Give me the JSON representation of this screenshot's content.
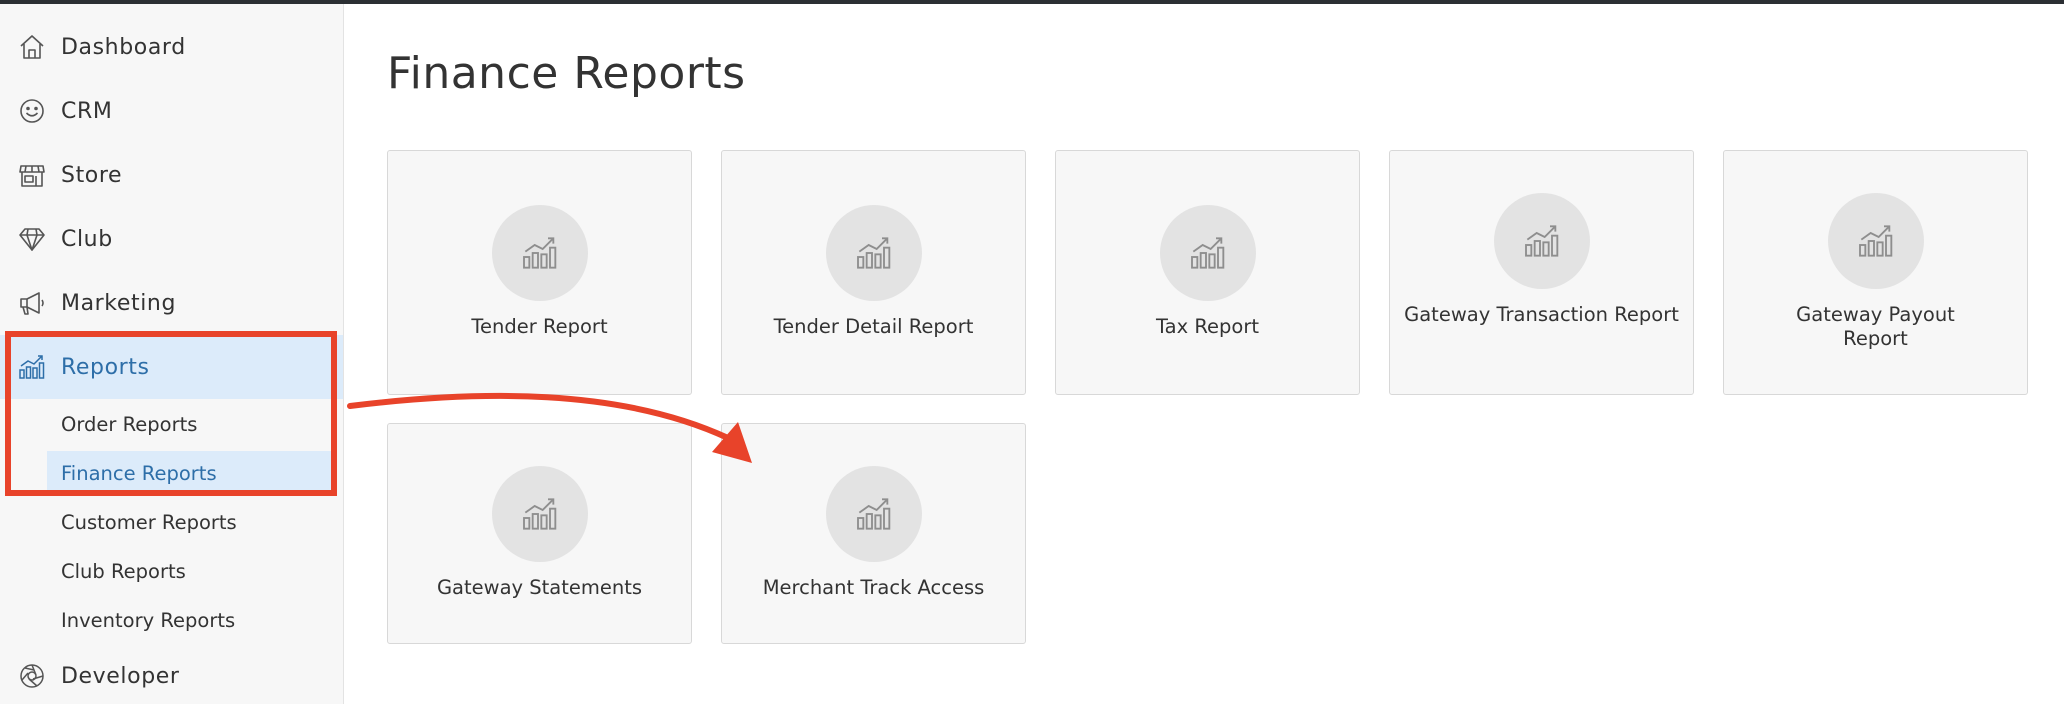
{
  "sidebar": {
    "items": [
      {
        "label": "Dashboard",
        "icon": "home-icon"
      },
      {
        "label": "CRM",
        "icon": "smiley-icon"
      },
      {
        "label": "Store",
        "icon": "storefront-icon"
      },
      {
        "label": "Club",
        "icon": "diamond-icon"
      },
      {
        "label": "Marketing",
        "icon": "megaphone-icon"
      },
      {
        "label": "Reports",
        "icon": "chart-icon",
        "active": true
      },
      {
        "label": "Developer",
        "icon": "aperture-icon"
      }
    ],
    "report_subitems": [
      {
        "label": "Order Reports"
      },
      {
        "label": "Finance Reports",
        "active": true
      },
      {
        "label": "Customer Reports"
      },
      {
        "label": "Club Reports"
      },
      {
        "label": "Inventory Reports"
      }
    ]
  },
  "main": {
    "title": "Finance Reports",
    "cards": [
      {
        "title": "Tender Report"
      },
      {
        "title": "Tender Detail Report"
      },
      {
        "title": "Tax Report"
      },
      {
        "title": "Gateway Transaction Report"
      },
      {
        "title": "Gateway Payout Report"
      },
      {
        "title": "Gateway Statements"
      },
      {
        "title": "Merchant Track Access"
      }
    ]
  },
  "colors": {
    "accent": "#2d6ea8",
    "active_bg": "#dcebfa",
    "annotation": "#e8432a"
  }
}
